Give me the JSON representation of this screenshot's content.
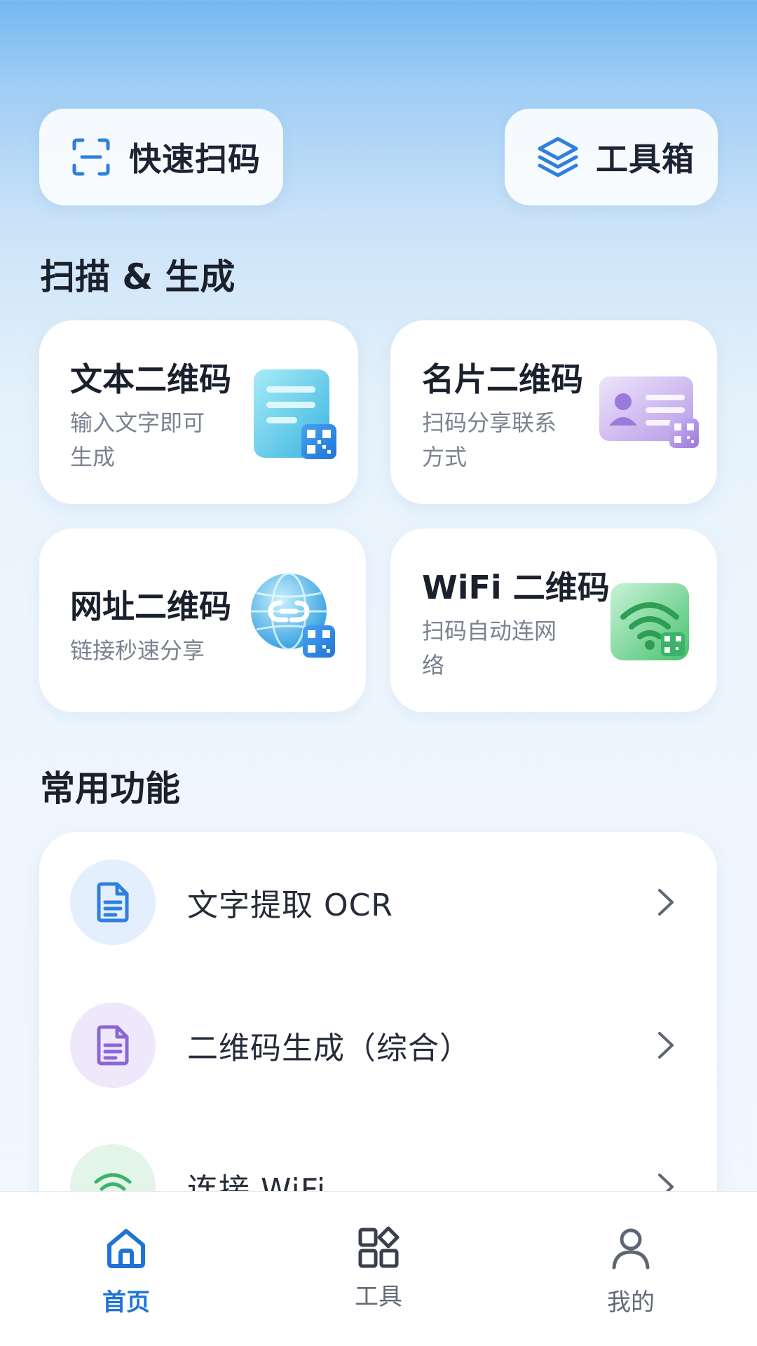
{
  "colors": {
    "accent": "#1f73d8",
    "text_primary": "#1a202c",
    "text_secondary": "#7b8290"
  },
  "top_actions": {
    "scan": {
      "label": "快速扫码",
      "icon": "scan-frame-icon"
    },
    "toolbox": {
      "label": "工具箱",
      "icon": "layers-icon"
    }
  },
  "section_scan_generate": {
    "title": "扫描 & 生成",
    "cards": [
      {
        "title": "文本二维码",
        "subtitle_line1": "输入文字即可",
        "subtitle_line2": "生成",
        "icon": "text-document-qr-icon"
      },
      {
        "title": "名片二维码",
        "subtitle_line1": "扫码分享联系",
        "subtitle_line2": "方式",
        "icon": "business-card-qr-icon"
      },
      {
        "title": "网址二维码",
        "subtitle_line1": "链接秒速分享",
        "subtitle_line2": "",
        "icon": "globe-link-qr-icon"
      },
      {
        "title": "WiFi 二维码",
        "subtitle_line1": "扫码自动连网",
        "subtitle_line2": "络",
        "icon": "wifi-qr-icon"
      }
    ]
  },
  "section_common": {
    "title": "常用功能",
    "items": [
      {
        "label": "文字提取 OCR",
        "icon": "document-icon",
        "icon_bg": "#e3effc",
        "icon_color": "#2f7fe0"
      },
      {
        "label": "二维码生成（综合）",
        "icon": "document-icon",
        "icon_bg": "#efe8fb",
        "icon_color": "#8a67d8"
      },
      {
        "label": "连接 WiFi",
        "icon": "wifi-icon",
        "icon_bg": "#e3f5e9",
        "icon_color": "#3cb36a"
      }
    ]
  },
  "tabbar": {
    "tabs": [
      {
        "label": "首页",
        "icon": "home-icon",
        "active": true
      },
      {
        "label": "工具",
        "icon": "grid-icon",
        "active": false
      },
      {
        "label": "我的",
        "icon": "user-icon",
        "active": false
      }
    ]
  }
}
